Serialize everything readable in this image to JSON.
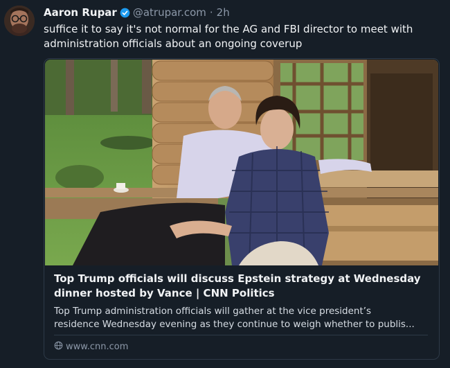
{
  "post": {
    "author": {
      "display_name": "Aaron Rupar",
      "handle": "@atrupar.com",
      "verified": true
    },
    "separator": "·",
    "time": "2h",
    "text": "suffice it to say it's not normal for the AG and FBI director to meet with administration officials about an ongoing coverup"
  },
  "link_card": {
    "title": "Top Trump officials will discuss Epstein strategy at Wednesday dinner hosted by Vance | CNN Politics",
    "description_lines": [
      "Top Trump administration officials will gather at the vice president’s",
      "residence Wednesday evening as they continue to weigh whether to publis..."
    ],
    "source": "www.cnn.com"
  },
  "icons": {
    "verified": "verified-badge-icon",
    "source": "globe-icon"
  },
  "colors": {
    "background": "#161e27",
    "muted_text": "#8c98a8",
    "verified_blue": "#1d9bf0",
    "border": "#2e3a48"
  }
}
